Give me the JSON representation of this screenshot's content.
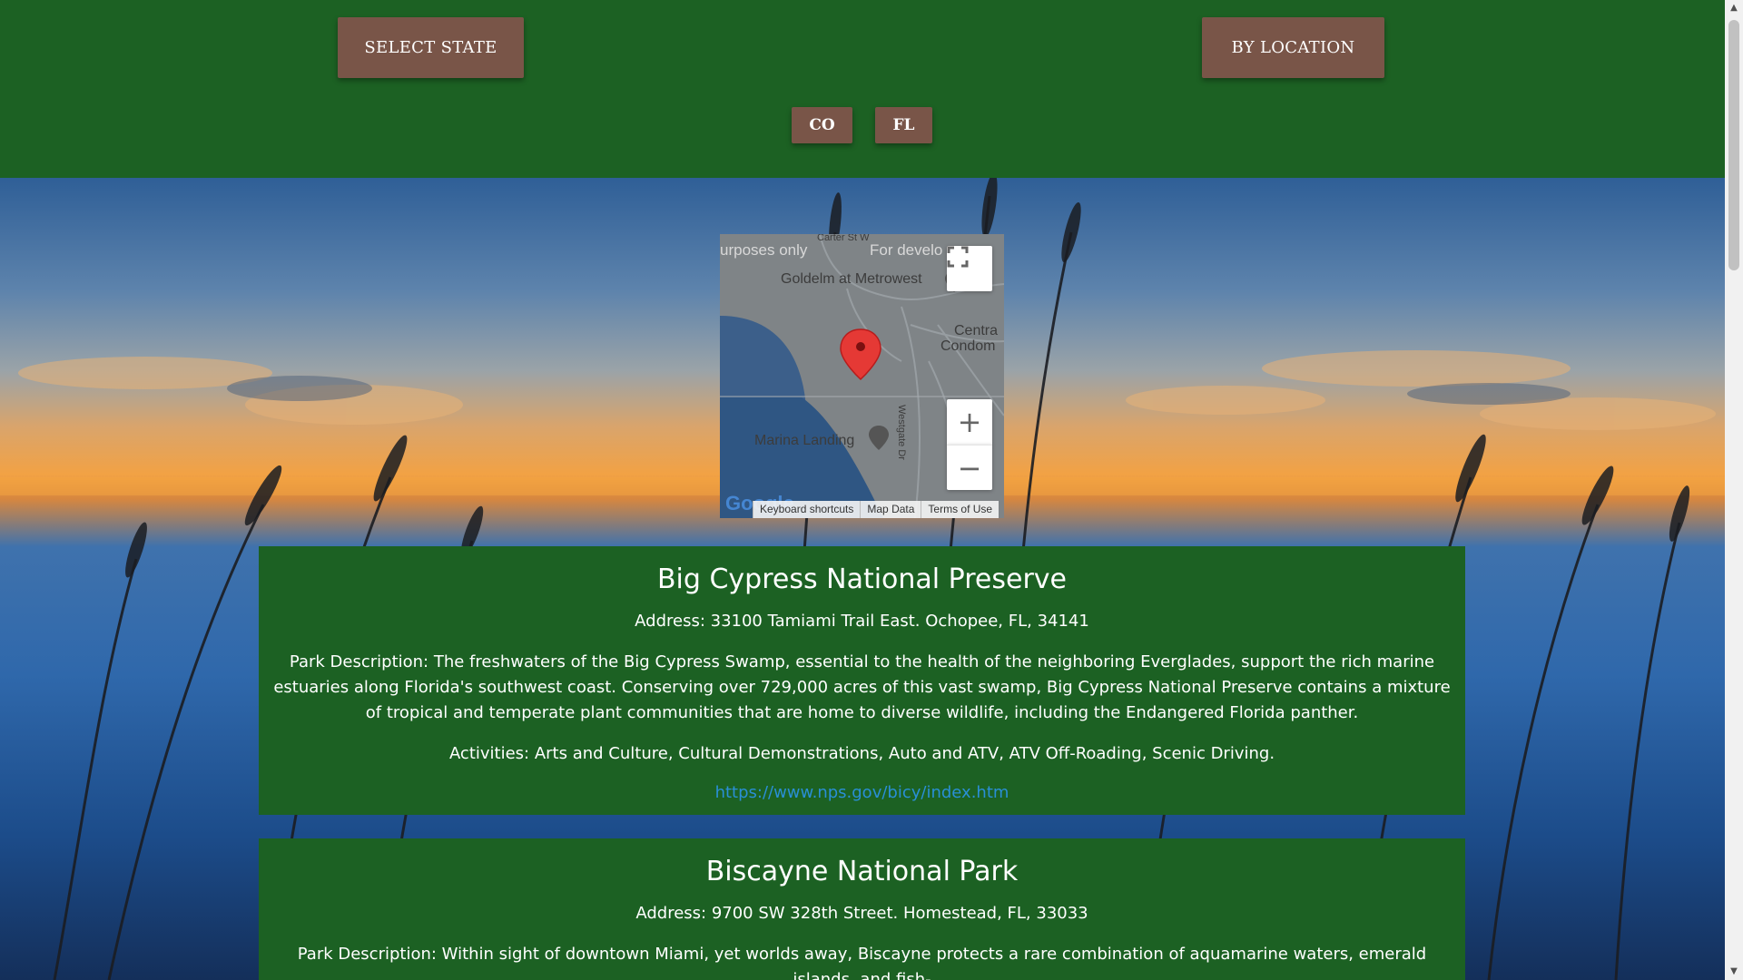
{
  "header": {
    "select_state_label": "SELECT STATE",
    "by_location_label": "BY LOCATION",
    "states": [
      "CO",
      "FL"
    ]
  },
  "map": {
    "labels": {
      "watermark_left": "urposes only",
      "watermark_right": "For develo",
      "goldelm": "Goldelm at Metrowest",
      "carter": "Carter St W",
      "marina": "Marina Landing",
      "central": "Centra",
      "condom": "Condom",
      "westgate": "Westgate Dr"
    },
    "zoom_in": "+",
    "zoom_out": "−",
    "footer": {
      "shortcuts": "Keyboard shortcuts",
      "map_data": "Map Data",
      "terms": "Terms of Use"
    },
    "logo": "Google"
  },
  "parks": [
    {
      "name": "Big Cypress National Preserve",
      "address": "Address: 33100 Tamiami Trail East. Ochopee, FL, 34141",
      "description": "Park Description: The freshwaters of the Big Cypress Swamp, essential to the health of the neighboring Everglades, support the rich marine estuaries along Florida's southwest coast. Conserving over 729,000 acres of this vast swamp, Big Cypress National Preserve contains a mixture of tropical and temperate plant communities that are home to diverse wildlife, including the Endangered Florida panther.",
      "activities": "Activities: Arts and Culture, Cultural Demonstrations, Auto and ATV, ATV Off-Roading, Scenic Driving.",
      "url": "https://www.nps.gov/bicy/index.htm"
    },
    {
      "name": "Biscayne National Park",
      "address": "Address: 9700 SW 328th Street. Homestead, FL, 33033",
      "description": "Park Description: Within sight of downtown Miami, yet worlds away, Biscayne protects a rare combination of aquamarine waters, emerald islands, and fish-"
    }
  ],
  "colors": {
    "header_green": "#1c6123",
    "button_brown": "#795548",
    "link_blue": "#2a8fd6"
  }
}
